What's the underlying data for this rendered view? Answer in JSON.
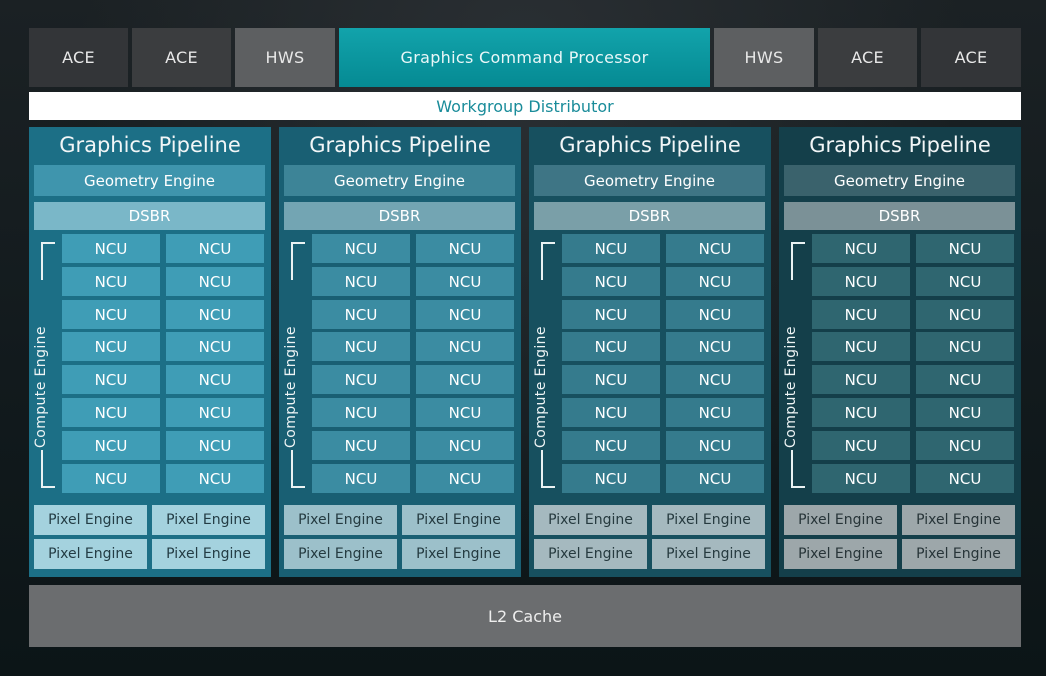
{
  "top_row": {
    "ace_1": "ACE",
    "ace_2": "ACE",
    "hws_1": "HWS",
    "gcp": "Graphics Command Processor",
    "hws_2": "HWS",
    "ace_3": "ACE",
    "ace_4": "ACE"
  },
  "workgroup_distributor": "Workgroup Distributor",
  "l2_cache": "L2 Cache",
  "pipelines": [
    {
      "title": "Graphics Pipeline",
      "geometry": "Geometry Engine",
      "dsbr": "DSBR",
      "compute_label": "Compute Engine",
      "ncu_label": "NCU",
      "ncu_rows": 8,
      "pixel_engines": [
        "Pixel Engine",
        "Pixel Engine",
        "Pixel Engine",
        "Pixel Engine"
      ]
    },
    {
      "title": "Graphics Pipeline",
      "geometry": "Geometry Engine",
      "dsbr": "DSBR",
      "compute_label": "Compute Engine",
      "ncu_label": "NCU",
      "ncu_rows": 8,
      "pixel_engines": [
        "Pixel Engine",
        "Pixel Engine",
        "Pixel Engine",
        "Pixel Engine"
      ]
    },
    {
      "title": "Graphics Pipeline",
      "geometry": "Geometry Engine",
      "dsbr": "DSBR",
      "compute_label": "Compute Engine",
      "ncu_label": "NCU",
      "ncu_rows": 8,
      "pixel_engines": [
        "Pixel Engine",
        "Pixel Engine",
        "Pixel Engine",
        "Pixel Engine"
      ]
    },
    {
      "title": "Graphics Pipeline",
      "geometry": "Geometry Engine",
      "dsbr": "DSBR",
      "compute_label": "Compute Engine",
      "ncu_label": "NCU",
      "ncu_rows": 8,
      "pixel_engines": [
        "Pixel Engine",
        "Pixel Engine",
        "Pixel Engine",
        "Pixel Engine"
      ]
    }
  ],
  "colors": {
    "pipeline_backgrounds": [
      "#1c6f86",
      "#195f73",
      "#17505f",
      "#143f4a"
    ],
    "geometry_backgrounds": [
      "#3f95ad",
      "#3d8497",
      "#3e7585",
      "#3a626c"
    ],
    "dsbr_backgrounds": [
      "#7ab7c8",
      "#73a5b3",
      "#7a9fa8",
      "#7b9197"
    ],
    "ncu_backgrounds": [
      "#3f9db6",
      "#3b8ca2",
      "#357b8d",
      "#2f6670"
    ],
    "pixel_backgrounds": [
      "#a4d2de",
      "#9cc0ca",
      "#a5b9bf",
      "#9da7aa"
    ],
    "pixel_text": [
      "#233c44",
      "#243a40",
      "#263a3f",
      "#273438"
    ]
  }
}
